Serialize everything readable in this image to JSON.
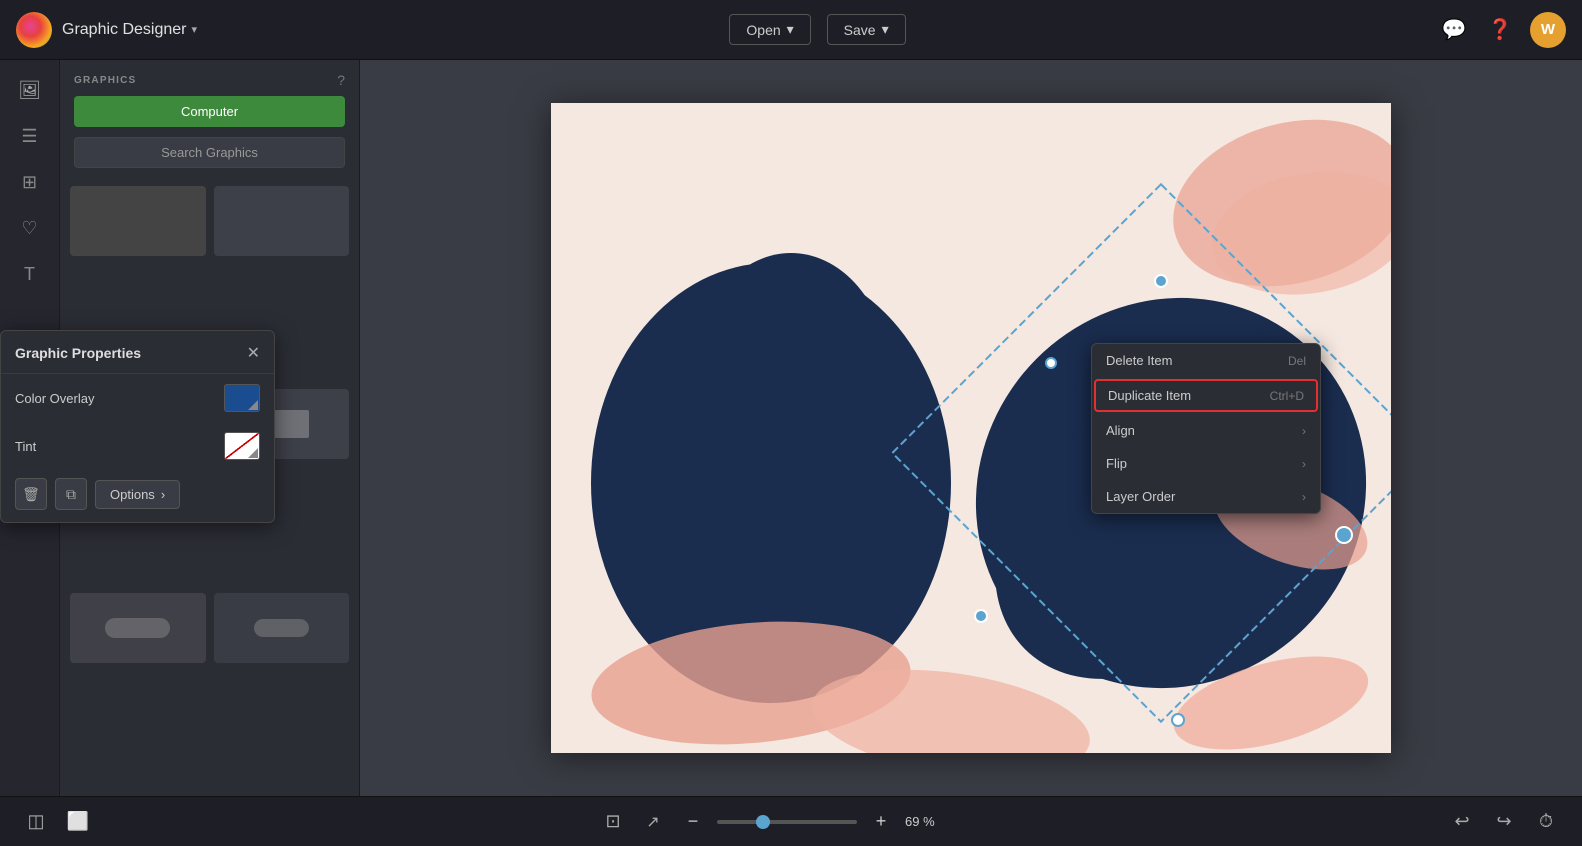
{
  "app": {
    "title": "Graphic Designer",
    "title_chevron": "▾",
    "logo_alt": "app-logo"
  },
  "topbar": {
    "open_label": "Open",
    "save_label": "Save",
    "open_chevron": "▾",
    "save_chevron": "▾"
  },
  "sidebar": {
    "icons": [
      "🖼",
      "☰",
      "⊞",
      "♡",
      "🔠"
    ]
  },
  "panel": {
    "title": "GRAPHICS",
    "help_icon": "?",
    "upload_btn_label": "Computer",
    "search_placeholder": "Search Graphics"
  },
  "graphic_properties": {
    "title": "Graphic Properties",
    "close_icon": "✕",
    "color_overlay_label": "Color Overlay",
    "tint_label": "Tint",
    "options_label": "Options",
    "options_arrow": "›",
    "delete_icon": "🗑",
    "duplicate_icon": "⧉"
  },
  "context_menu": {
    "items": [
      {
        "label": "Delete Item",
        "shortcut": "Del",
        "highlighted": false,
        "has_arrow": false
      },
      {
        "label": "Duplicate Item",
        "shortcut": "Ctrl+D",
        "highlighted": true,
        "has_arrow": false
      },
      {
        "label": "Align",
        "shortcut": "",
        "highlighted": false,
        "has_arrow": true
      },
      {
        "label": "Flip",
        "shortcut": "",
        "highlighted": false,
        "has_arrow": true
      },
      {
        "label": "Layer Order",
        "shortcut": "",
        "highlighted": false,
        "has_arrow": true
      }
    ]
  },
  "bottombar": {
    "layers_icon": "◫",
    "pages_icon": "⬜",
    "frame_icon": "⊡",
    "export_icon": "↗",
    "zoom_minus": "−",
    "zoom_plus": "+",
    "zoom_value": 69,
    "zoom_pct": "69 %",
    "undo_icon": "↩",
    "redo_icon": "↪",
    "history_icon": "⏱"
  },
  "colors": {
    "accent_blue": "#5ba4cf",
    "selection_border": "#5ba4cf",
    "overlay_blue": "#1a4d8f",
    "context_highlight": "#e03030",
    "upload_green": "#3d8a3d"
  }
}
